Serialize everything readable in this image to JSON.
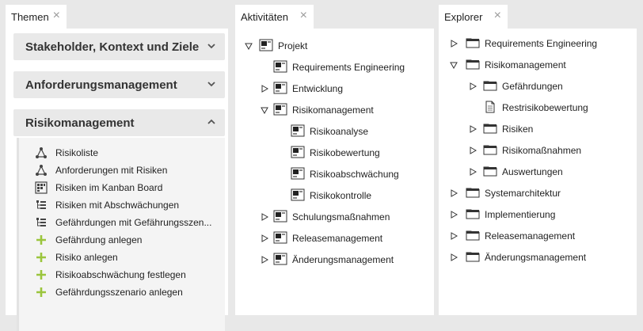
{
  "themen": {
    "tab_title": "Themen",
    "close": "×",
    "sections": [
      {
        "label": "Stakeholder, Kontext und Ziele",
        "expanded": false
      },
      {
        "label": "Anforderungsmanagement",
        "expanded": false
      },
      {
        "label": "Risikomanagement",
        "expanded": true
      }
    ],
    "items": [
      {
        "label": "Risikoliste",
        "icon": "graph-icon"
      },
      {
        "label": "Anforderungen mit Risiken",
        "icon": "graph-icon"
      },
      {
        "label": "Risiken im Kanban Board",
        "icon": "kanban-icon"
      },
      {
        "label": "Risiken mit Abschwächungen",
        "icon": "hierarchy-icon"
      },
      {
        "label": "Gefährdungen mit Gefährungsszen...",
        "icon": "hierarchy-icon"
      },
      {
        "label": "Gefährdung anlegen",
        "icon": "plus-icon"
      },
      {
        "label": "Risiko anlegen",
        "icon": "plus-icon"
      },
      {
        "label": "Risikoabschwächung festlegen",
        "icon": "plus-icon"
      },
      {
        "label": "Gefährdungsszenario anlegen",
        "icon": "plus-icon"
      }
    ]
  },
  "aktivitaeten": {
    "tab_title": "Aktivitäten",
    "close": "×",
    "root": "Projekt",
    "items": [
      {
        "label": "Requirements Engineering",
        "toggle": "none",
        "level": 1
      },
      {
        "label": "Entwicklung",
        "toggle": "collapsed",
        "level": 1
      },
      {
        "label": "Risikomanagement",
        "toggle": "expanded",
        "level": 1
      },
      {
        "label": "Risikoanalyse",
        "toggle": "none",
        "level": 2
      },
      {
        "label": "Risikobewertung",
        "toggle": "none",
        "level": 2
      },
      {
        "label": "Risikoabschwächung",
        "toggle": "none",
        "level": 2
      },
      {
        "label": "Risikokontrolle",
        "toggle": "none",
        "level": 2
      },
      {
        "label": "Schulungsmaßnahmen",
        "toggle": "collapsed",
        "level": 1
      },
      {
        "label": "Releasemanagement",
        "toggle": "collapsed",
        "level": 1
      },
      {
        "label": "Änderungsmanagement",
        "toggle": "collapsed",
        "level": 1
      }
    ]
  },
  "explorer": {
    "tab_title": "Explorer",
    "close": "×",
    "items": [
      {
        "label": "Requirements Engineering",
        "toggle": "collapsed",
        "level": 0,
        "icon": "folder"
      },
      {
        "label": "Risikomanagement",
        "toggle": "expanded",
        "level": 0,
        "icon": "folder"
      },
      {
        "label": "Gefährdungen",
        "toggle": "collapsed",
        "level": 1,
        "icon": "folder"
      },
      {
        "label": "Restrisikobewertung",
        "toggle": "none",
        "level": 1,
        "icon": "document"
      },
      {
        "label": "Risiken",
        "toggle": "collapsed",
        "level": 1,
        "icon": "folder"
      },
      {
        "label": "Risikomaßnahmen",
        "toggle": "collapsed",
        "level": 1,
        "icon": "folder"
      },
      {
        "label": "Auswertungen",
        "toggle": "collapsed",
        "level": 1,
        "icon": "folder"
      },
      {
        "label": "Systemarchitektur",
        "toggle": "collapsed",
        "level": 0,
        "icon": "folder"
      },
      {
        "label": "Implementierung",
        "toggle": "collapsed",
        "level": 0,
        "icon": "folder"
      },
      {
        "label": "Releasemanagement",
        "toggle": "collapsed",
        "level": 0,
        "icon": "folder"
      },
      {
        "label": "Änderungsmanagement",
        "toggle": "collapsed",
        "level": 0,
        "icon": "folder"
      }
    ]
  },
  "colors": {
    "plus": "#9bc53d",
    "background": "#e8e8e8",
    "panel": "#ffffff"
  }
}
